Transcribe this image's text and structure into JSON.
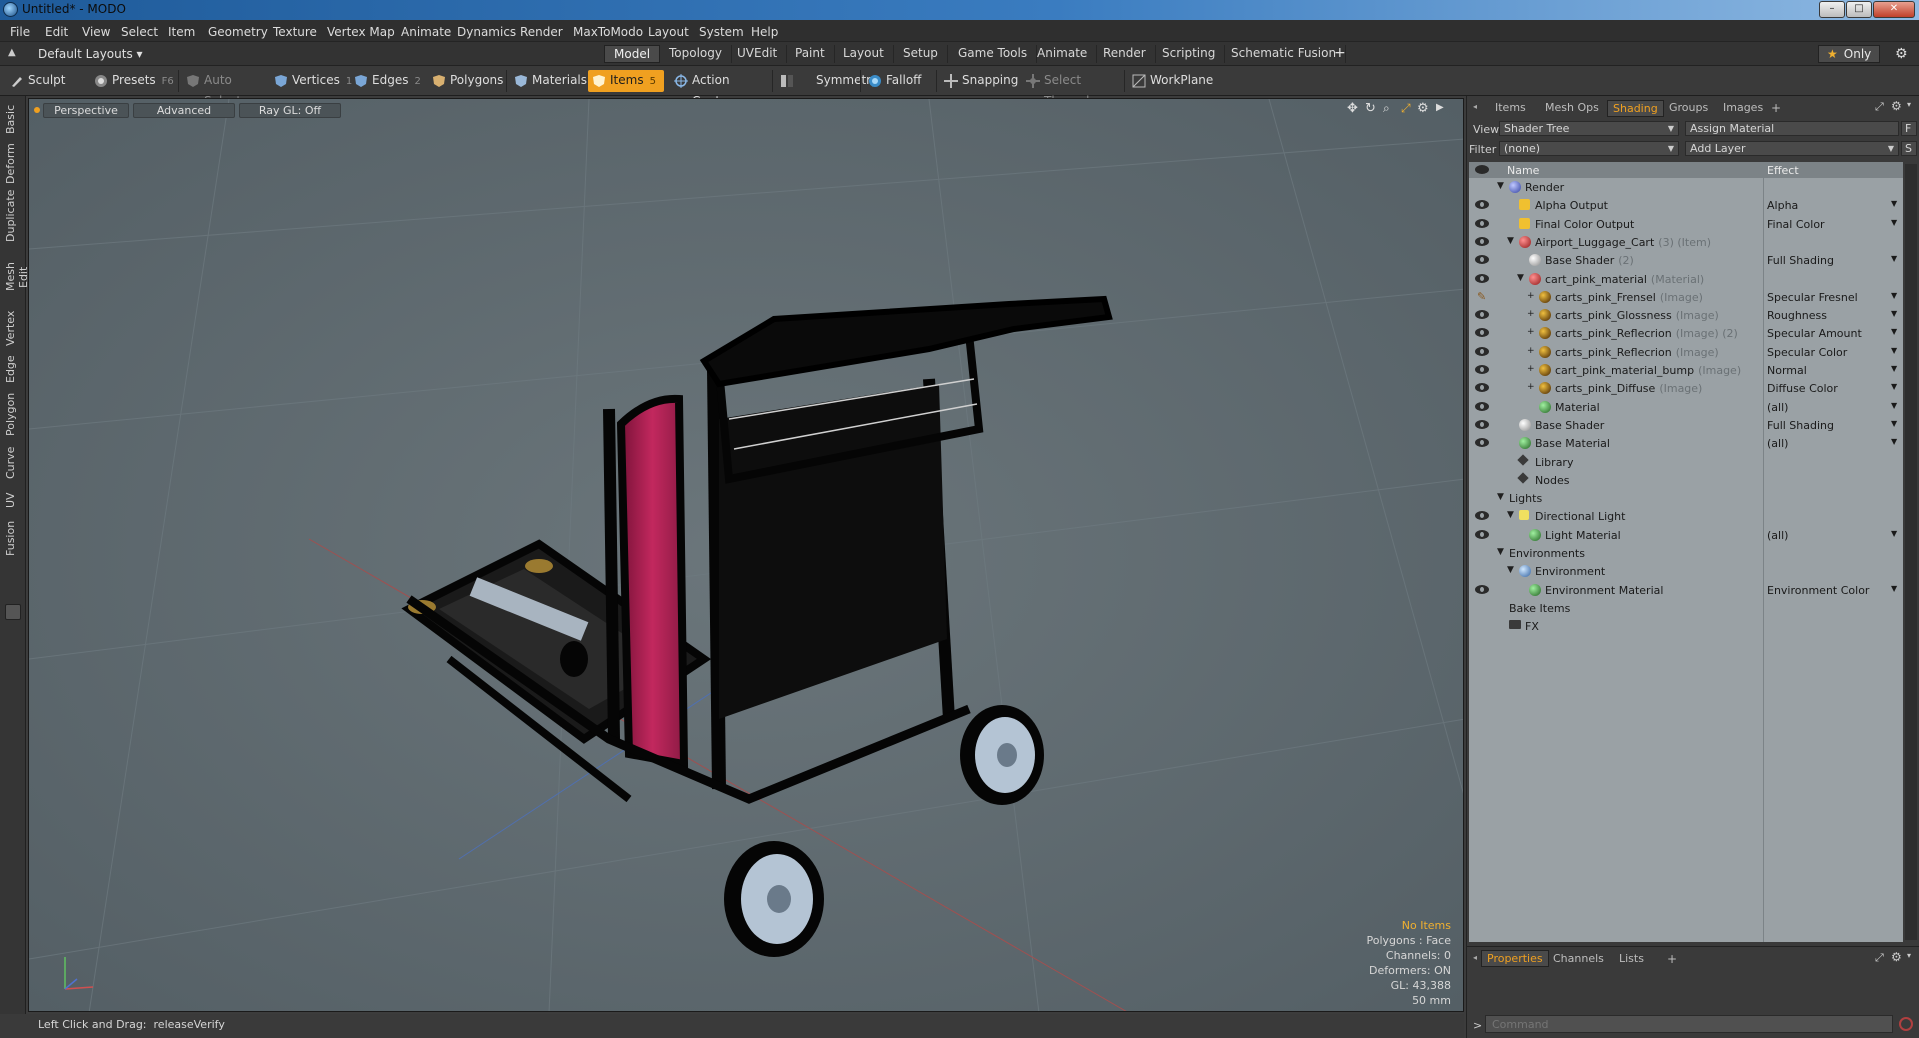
{
  "window": {
    "title": "Untitled* - MODO",
    "controls": [
      "–",
      "□",
      "✕"
    ]
  },
  "menu": [
    "File",
    "Edit",
    "View",
    "Select",
    "Item",
    "Geometry",
    "Texture",
    "Vertex Map",
    "Animate",
    "Dynamics",
    "Render",
    "MaxToModo",
    "Layout",
    "System",
    "Help"
  ],
  "layout_bar": {
    "preset": "Default Layouts",
    "tabs": [
      "Model",
      "Topology",
      "UVEdit",
      "Paint",
      "Layout",
      "Setup",
      "Game Tools",
      "Animate",
      "Render",
      "Scripting",
      "Schematic Fusion"
    ],
    "active_tab": "Model",
    "add": "+",
    "only_label": "Only"
  },
  "toolbar": {
    "sculpt": "Sculpt",
    "presets": "Presets",
    "presets_key": "F6",
    "auto_select": "Auto Select",
    "vertices": "Vertices",
    "vertices_key": "1",
    "edges": "Edges",
    "edges_key": "2",
    "polygons": "Polygons",
    "materials": "Materials",
    "items": "Items",
    "items_key": "5",
    "action_center": "Action Center",
    "symmetry": "Symmetry",
    "falloff": "Falloff",
    "snapping": "Snapping",
    "select_through": "Select Through",
    "workplane": "WorkPlane"
  },
  "left_tabs": [
    "Basic",
    "Deform",
    "Duplicate",
    "Mesh Edit",
    "Vertex",
    "Edge",
    "Polygon",
    "Curve",
    "UV",
    "Fusion"
  ],
  "viewport": {
    "view_mode": "Perspective",
    "shading": "Advanced",
    "raygl": "Ray GL: Off",
    "info": {
      "items": "No Items",
      "polygons": "Polygons : Face",
      "channels": "Channels: 0",
      "deformers": "Deformers: ON",
      "gl": "GL: 43,388",
      "scale": "50 mm"
    }
  },
  "status": {
    "label": "Left Click and Drag:",
    "value": "releaseVerify"
  },
  "right_panel": {
    "tabs": [
      "Items",
      "Mesh Ops",
      "Shading",
      "Groups",
      "Images"
    ],
    "active_tab": "Shading",
    "add": "+",
    "view_label": "View",
    "view_value": "Shader Tree",
    "assign_material": "Assign Material",
    "assign_key": "F",
    "filter_label": "Filter",
    "filter_value": "(none)",
    "add_layer": "Add Layer",
    "add_layer_key": "S",
    "tree_headers": {
      "name": "Name",
      "effect": "Effect"
    },
    "rows": [
      {
        "name": "Render",
        "sub": "",
        "effect": "",
        "level": 0,
        "eye": false,
        "icon": "render",
        "twirl": "▼"
      },
      {
        "name": "Alpha Output",
        "sub": "",
        "effect": "Alpha",
        "level": 1,
        "eye": true,
        "icon": "output",
        "twirl": ""
      },
      {
        "name": "Final Color Output",
        "sub": "",
        "effect": "Final Color",
        "level": 1,
        "eye": true,
        "icon": "output",
        "twirl": ""
      },
      {
        "name": "Airport_Luggage_Cart",
        "sub": "(3) (Item)",
        "effect": "",
        "level": 1,
        "eye": true,
        "icon": "mask",
        "twirl": "▼"
      },
      {
        "name": "Base Shader",
        "sub": "(2)",
        "effect": "Full Shading",
        "level": 2,
        "eye": true,
        "icon": "shader",
        "twirl": ""
      },
      {
        "name": "cart_pink_material",
        "sub": "(Material)",
        "effect": "",
        "level": 2,
        "eye": true,
        "icon": "mask",
        "twirl": "▼"
      },
      {
        "name": "carts_pink_Frensel",
        "sub": "(Image)",
        "effect": "Specular Fresnel",
        "level": 3,
        "eye": false,
        "brush": true,
        "icon": "image",
        "twirl": "+"
      },
      {
        "name": "carts_pink_Glossness",
        "sub": "(Image)",
        "effect": "Roughness",
        "level": 3,
        "eye": true,
        "icon": "image",
        "twirl": "+"
      },
      {
        "name": "carts_pink_Reflecrion",
        "sub": "(Image) (2)",
        "effect": "Specular Amount",
        "level": 3,
        "eye": true,
        "icon": "image",
        "twirl": "+"
      },
      {
        "name": "carts_pink_Reflecrion",
        "sub": "(Image)",
        "effect": "Specular Color",
        "level": 3,
        "eye": true,
        "icon": "image",
        "twirl": "+"
      },
      {
        "name": "cart_pink_material_bump",
        "sub": "(Image)",
        "effect": "Normal",
        "level": 3,
        "eye": true,
        "icon": "image",
        "twirl": "+"
      },
      {
        "name": "carts_pink_Diffuse",
        "sub": "(Image)",
        "effect": "Diffuse Color",
        "level": 3,
        "eye": true,
        "icon": "image",
        "twirl": "+"
      },
      {
        "name": "Material",
        "sub": "",
        "effect": "(all)",
        "level": 3,
        "eye": true,
        "icon": "material",
        "twirl": ""
      },
      {
        "name": "Base Shader",
        "sub": "",
        "effect": "Full Shading",
        "level": 1,
        "eye": true,
        "icon": "shader",
        "twirl": ""
      },
      {
        "name": "Base Material",
        "sub": "",
        "effect": "(all)",
        "level": 1,
        "eye": true,
        "icon": "material",
        "twirl": ""
      },
      {
        "name": "Library",
        "sub": "",
        "effect": "",
        "level": 1,
        "eye": false,
        "icon": "folder",
        "twirl": ""
      },
      {
        "name": "Nodes",
        "sub": "",
        "effect": "",
        "level": 1,
        "eye": false,
        "icon": "folder",
        "twirl": ""
      },
      {
        "name": "Lights",
        "sub": "",
        "effect": "",
        "level": 0,
        "eye": false,
        "icon": "none",
        "twirl": "▼"
      },
      {
        "name": "Directional Light",
        "sub": "",
        "effect": "",
        "level": 1,
        "eye": true,
        "icon": "light",
        "twirl": "▼"
      },
      {
        "name": "Light Material",
        "sub": "",
        "effect": "(all)",
        "level": 2,
        "eye": true,
        "icon": "material",
        "twirl": ""
      },
      {
        "name": "Environments",
        "sub": "",
        "effect": "",
        "level": 0,
        "eye": false,
        "icon": "none",
        "twirl": "▼"
      },
      {
        "name": "Environment",
        "sub": "",
        "effect": "",
        "level": 1,
        "eye": false,
        "icon": "environment",
        "twirl": "▼"
      },
      {
        "name": "Environment Material",
        "sub": "",
        "effect": "Environment Color",
        "level": 2,
        "eye": true,
        "icon": "material",
        "twirl": ""
      },
      {
        "name": "Bake Items",
        "sub": "",
        "effect": "",
        "level": 0,
        "eye": false,
        "icon": "none",
        "twirl": ""
      },
      {
        "name": "FX",
        "sub": "",
        "effect": "",
        "level": 0,
        "eye": false,
        "icon": "fx",
        "twirl": ""
      }
    ],
    "bottom_tabs": [
      "Properties",
      "Channels",
      "Lists"
    ],
    "bottom_active": "Properties",
    "command_placeholder": "Command",
    "command_prompt": ">"
  },
  "colors": {
    "accent": "#f0a020",
    "viewport_bg": "#5e6a70",
    "cart_pink": "#c2285e",
    "tree_bg": "#9aa1a5"
  }
}
